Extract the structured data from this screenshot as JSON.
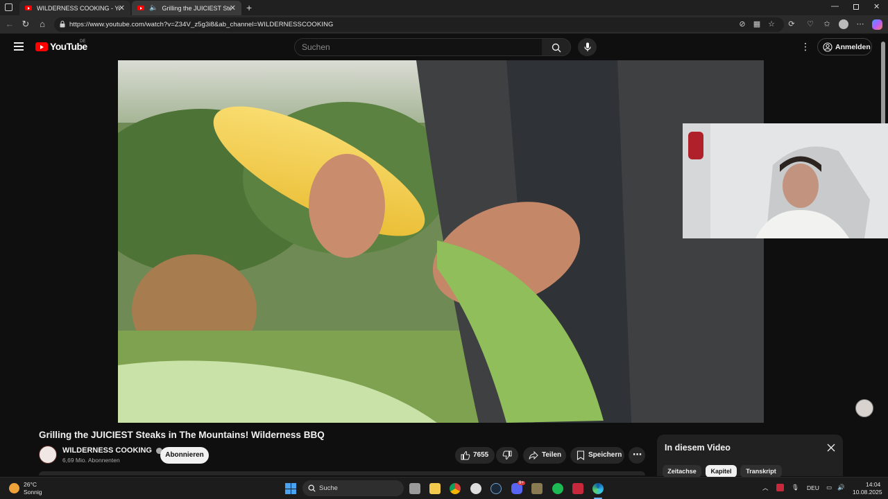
{
  "browser": {
    "tabs": [
      {
        "label": "WILDERNESS COOKING - YouTube",
        "active": false
      },
      {
        "label": "Grilling the JUICIEST Steaks in",
        "active": true
      }
    ],
    "url": "https://www.youtube.com/watch?v=Z34V_z5g3i8&ab_channel=WILDERNESSCOOKING"
  },
  "youtube": {
    "logo_text": "YouTube",
    "country_code": "DE",
    "search_placeholder": "Suchen",
    "signin_label": "Anmelden"
  },
  "video": {
    "title": "Grilling the JUICIEST Steaks in The Mountains! Wilderness BBQ",
    "channel_name": "WILDERNESS COOKING",
    "subscribers": "6,69 Mio. Abonnenten",
    "subscribe_label": "Abonnieren",
    "likes": "7655",
    "share_label": "Teilen",
    "save_label": "Speichern"
  },
  "panel": {
    "title": "In diesem Video",
    "chips": [
      "Zeitachse",
      "Kapitel",
      "Transkript"
    ],
    "active_chip": "Kapitel"
  },
  "taskbar": {
    "weather_temp": "26°C",
    "weather_desc": "Sonnig",
    "search_label": "Suche",
    "language": "DEU",
    "time": "14:04",
    "date": "10.08.2025",
    "discord_badge": "9+"
  },
  "colors": {
    "yt_red": "#ff0000",
    "background": "#0f0f0f"
  }
}
